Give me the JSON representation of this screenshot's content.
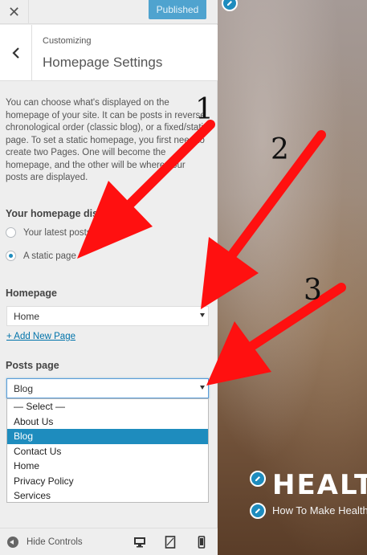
{
  "topbar": {
    "close_label": "✕",
    "publish_label": "Published"
  },
  "header": {
    "breadcrumb": "Customizing",
    "title": "Homepage Settings"
  },
  "description": "You can choose what's displayed on the homepage of your site. It can be posts in reverse chronological order (classic blog), or a fixed/static page. To set a static homepage, you first need to create two Pages. One will become the homepage, and the other will be where your posts are displayed.",
  "homepage_displays": {
    "label": "Your homepage displays",
    "options": [
      "Your latest posts",
      "A static page"
    ],
    "selected": "A static page"
  },
  "homepage": {
    "label": "Homepage",
    "value": "Home",
    "add_link": "+ Add New Page"
  },
  "posts_page": {
    "label": "Posts page",
    "value": "Blog",
    "options": [
      "— Select —",
      "About Us",
      "Blog",
      "Contact Us",
      "Home",
      "Privacy Policy",
      "Services"
    ],
    "highlighted": "Blog"
  },
  "footer": {
    "hide_controls_label": "Hide Controls",
    "devices": [
      "desktop-icon",
      "tablet-icon",
      "mobile-icon"
    ]
  },
  "preview": {
    "site_title": "HEALTH",
    "site_tagline": "How To Make Health"
  },
  "annotations": {
    "numbers": [
      "1",
      "2",
      "3"
    ],
    "arrow_color": "#ff1010"
  },
  "colors": {
    "accent": "#1e8cbe",
    "publish": "#4fa3cf",
    "link": "#0073aa"
  }
}
